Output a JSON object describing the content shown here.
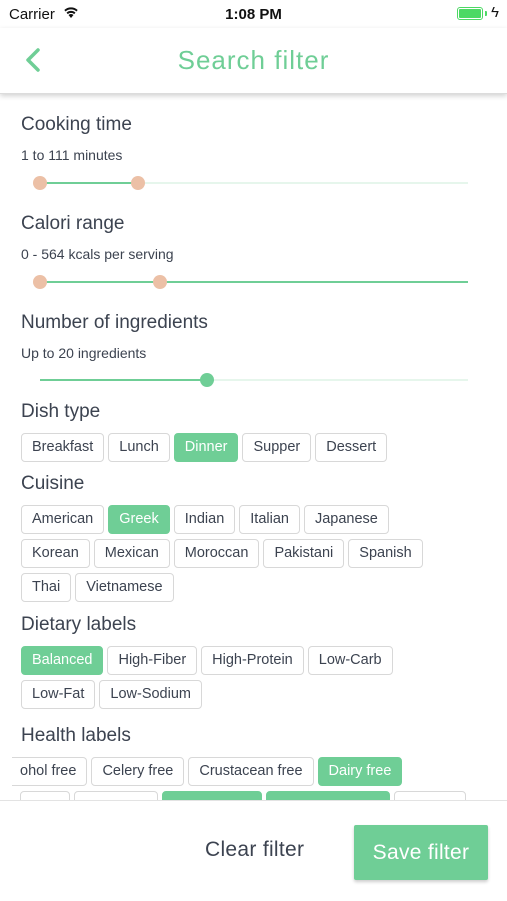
{
  "status_bar": {
    "carrier": "Carrier",
    "time": "1:08 PM",
    "battery_level": 1.0
  },
  "nav": {
    "title": "Search filter"
  },
  "cooking_time": {
    "title": "Cooking time",
    "summary": "1 to 111 minutes",
    "min": 1,
    "max": 111
  },
  "calorie_range": {
    "title": "Calori range",
    "summary": "0 - 564 kcals per serving",
    "min": 0,
    "max": 564
  },
  "ingredients": {
    "title": "Number of ingredients",
    "summary": "Up to 20 ingredients",
    "value": 20
  },
  "dish_type": {
    "title": "Dish type",
    "options": [
      {
        "label": "Breakfast",
        "selected": false
      },
      {
        "label": "Lunch",
        "selected": false
      },
      {
        "label": "Dinner",
        "selected": true
      },
      {
        "label": "Supper",
        "selected": false
      },
      {
        "label": "Dessert",
        "selected": false
      }
    ]
  },
  "cuisine": {
    "title": "Cuisine",
    "options": [
      {
        "label": "American",
        "selected": false
      },
      {
        "label": "Greek",
        "selected": true
      },
      {
        "label": "Indian",
        "selected": false
      },
      {
        "label": "Italian",
        "selected": false
      },
      {
        "label": "Japanese",
        "selected": false
      },
      {
        "label": "Korean",
        "selected": false
      },
      {
        "label": "Mexican",
        "selected": false
      },
      {
        "label": "Moroccan",
        "selected": false
      },
      {
        "label": "Pakistani",
        "selected": false
      },
      {
        "label": "Spanish",
        "selected": false
      },
      {
        "label": "Thai",
        "selected": false
      },
      {
        "label": "Vietnamese",
        "selected": false
      }
    ]
  },
  "dietary_labels": {
    "title": "Dietary labels",
    "options": [
      {
        "label": "Balanced",
        "selected": true
      },
      {
        "label": "High-Fiber",
        "selected": false
      },
      {
        "label": "High-Protein",
        "selected": false
      },
      {
        "label": "Low-Carb",
        "selected": false
      },
      {
        "label": "Low-Fat",
        "selected": false
      },
      {
        "label": "Low-Sodium",
        "selected": false
      }
    ]
  },
  "health_labels": {
    "title": "Health labels",
    "row1": [
      {
        "label": "ohol free",
        "selected": false
      },
      {
        "label": "Celery free",
        "selected": false
      },
      {
        "label": "Crustacean free",
        "selected": false
      },
      {
        "label": "Dairy free",
        "selected": true
      }
    ]
  },
  "footer": {
    "clear_label": "Clear filter",
    "save_label": "Save filter"
  },
  "colors": {
    "accent": "#6fce96",
    "thumb_peach": "#ecc0a6",
    "text": "#3c4350"
  }
}
